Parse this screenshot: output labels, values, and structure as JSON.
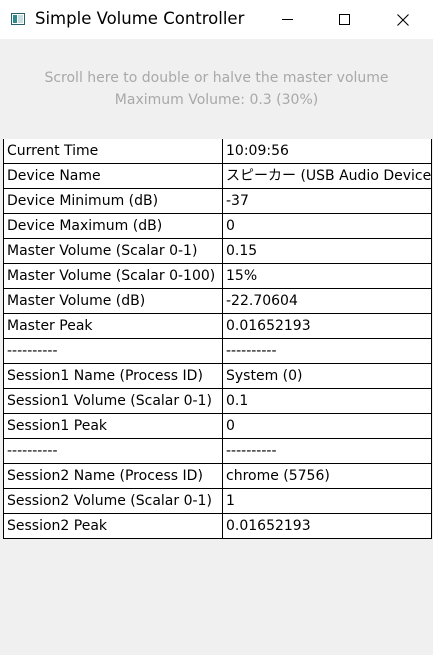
{
  "window": {
    "title": "Simple Volume Controller",
    "icon": "app-window-icon",
    "controls": {
      "minimize": "minimize-icon",
      "maximize": "maximize-icon",
      "close": "close-icon"
    }
  },
  "info": {
    "line1": "Scroll here to double or halve the master volume",
    "line2": "Maximum Volume: 0.3 (30%)"
  },
  "rows": [
    {
      "label": "Current Time",
      "value": "10:09:56"
    },
    {
      "label": "Device Name",
      "value": "スピーカー (USB Audio Device)"
    },
    {
      "label": "Device Minimum (dB)",
      "value": "-37"
    },
    {
      "label": "Device Maximum (dB)",
      "value": "0"
    },
    {
      "label": "Master Volume (Scalar 0-1)",
      "value": "0.15"
    },
    {
      "label": "Master Volume (Scalar 0-100)",
      "value": "15%"
    },
    {
      "label": "Master Volume (dB)",
      "value": "-22.70604"
    },
    {
      "label": "Master Peak",
      "value": "0.01652193"
    },
    {
      "label": "----------",
      "value": "----------"
    },
    {
      "label": "Session1 Name (Process ID)",
      "value": "System (0)"
    },
    {
      "label": "Session1 Volume (Scalar 0-1)",
      "value": "0.1"
    },
    {
      "label": "Session1 Peak",
      "value": "0"
    },
    {
      "label": "----------",
      "value": "----------"
    },
    {
      "label": "Session2 Name (Process ID)",
      "value": "chrome (5756)"
    },
    {
      "label": "Session2 Volume (Scalar 0-1)",
      "value": "1"
    },
    {
      "label": "Session2 Peak",
      "value": "0.01652193"
    }
  ]
}
